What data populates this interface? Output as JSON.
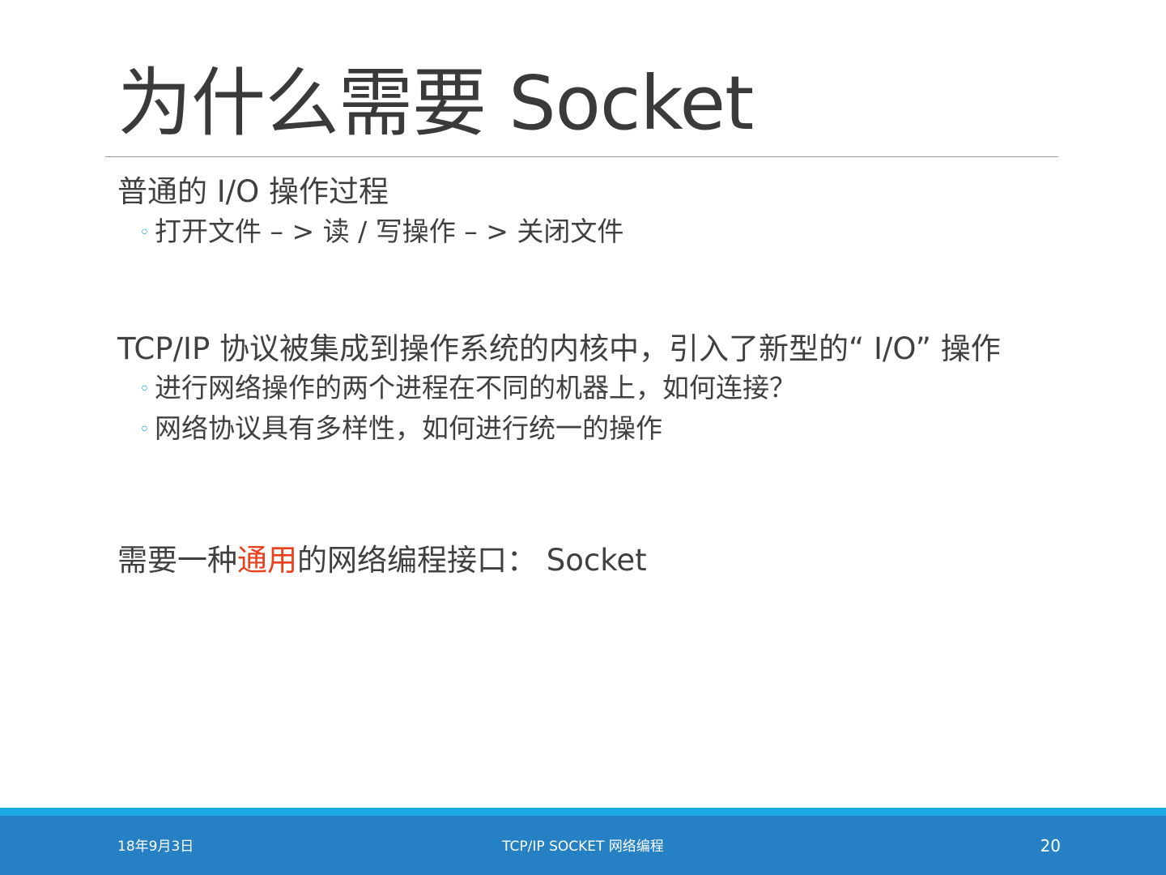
{
  "slide": {
    "title": "为什么需要 Socket",
    "blocks": [
      {
        "heading": "普通的 I/O 操作过程",
        "bullets": [
          "打开文件 – > 读 / 写操作 – > 关闭文件"
        ]
      },
      {
        "heading": "TCP/IP 协议被集成到操作系统的内核中，引入了新型的“ I/O” 操作",
        "bullets": [
          "进行网络操作的两个进程在不同的机器上，如何连接？",
          "网络协议具有多样性，如何进行统一的操作"
        ]
      }
    ],
    "conclusion": {
      "before": "需要一种",
      "highlight": "通用",
      "after": "的网络编程接口： Socket"
    },
    "bullet_glyph": "◦"
  },
  "footer": {
    "date": "18年9月3日",
    "center": "TCP/IP SOCKET 网络编程",
    "page": "20"
  },
  "colors": {
    "text": "#404040",
    "accent": "#e8401c",
    "bullet": "#1ba1d8",
    "footer_band": "#2580c4",
    "footer_stripe": "#1ba9e1"
  }
}
